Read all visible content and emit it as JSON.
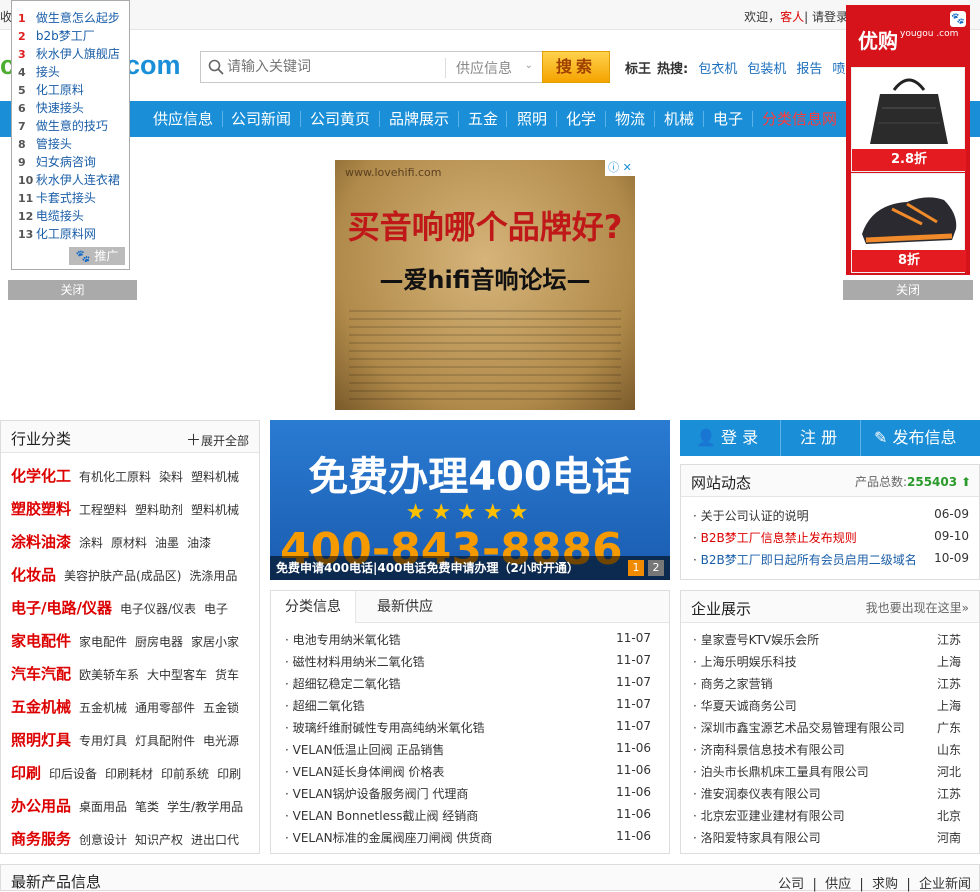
{
  "topbar": {
    "fav": "收",
    "welcome": "欢迎，",
    "guest": "客人",
    "login_hint": "| 请登录"
  },
  "logo": {
    "text": "com"
  },
  "search": {
    "placeholder": "请输入关键词",
    "category": "供应信息",
    "button": "搜索"
  },
  "hot": {
    "label1": "标王",
    "label2": "热搜:",
    "links": [
      "包衣机",
      "包装机",
      "报告",
      "喷雾"
    ]
  },
  "nav": {
    "items": [
      "供应信息",
      "公司新闻",
      "公司黄页",
      "品牌展示",
      "五金",
      "照明",
      "化学",
      "物流",
      "机械",
      "电子",
      "分类信息网"
    ]
  },
  "left_float": {
    "items": [
      {
        "n": "1",
        "t": "做生意怎么起步"
      },
      {
        "n": "2",
        "t": "b2b梦工厂"
      },
      {
        "n": "3",
        "t": "秋水伊人旗舰店"
      },
      {
        "n": "4",
        "t": "接头"
      },
      {
        "n": "5",
        "t": "化工原料"
      },
      {
        "n": "6",
        "t": "快速接头"
      },
      {
        "n": "7",
        "t": "做生意的技巧"
      },
      {
        "n": "8",
        "t": "管接头"
      },
      {
        "n": "9",
        "t": "妇女病咨询"
      },
      {
        "n": "10",
        "t": "秋水伊人连衣裙"
      },
      {
        "n": "11",
        "t": "卡套式接头"
      },
      {
        "n": "12",
        "t": "电缆接头"
      },
      {
        "n": "13",
        "t": "化工原料网"
      }
    ],
    "promo": "推广",
    "close": "关闭"
  },
  "right_float": {
    "brand": "优购",
    "brand_sub": "yougou .com",
    "prices": [
      "2.8折",
      "8折"
    ],
    "close": "关闭"
  },
  "ad": {
    "url": "www.lovehifi.com",
    "headline": "买音响哪个品牌好?",
    "subline": "—爱hifi音响论坛—"
  },
  "industry": {
    "title": "行业分类",
    "expand": "展开全部",
    "rows": [
      {
        "main": "化学化工",
        "subs": [
          "有机化工原料",
          "染料",
          "塑料机械"
        ]
      },
      {
        "main": "塑胶塑料",
        "subs": [
          "工程塑料",
          "塑料助剂",
          "塑料机械"
        ]
      },
      {
        "main": "涂料油漆",
        "subs": [
          "涂料",
          "原材料",
          "油墨",
          "油漆"
        ]
      },
      {
        "main": "化妆品",
        "subs": [
          "美容护肤产品(成品区)",
          "洗涤用品"
        ]
      },
      {
        "main": "电子/电路/仪器",
        "subs": [
          "电子仪器",
          "/仪表",
          "电子"
        ]
      },
      {
        "main": "家电配件",
        "subs": [
          "家电配件",
          "厨房电器",
          "家居小家"
        ]
      },
      {
        "main": "汽车汽配",
        "subs": [
          "欧美轿车系",
          "大中型客车",
          "货车"
        ]
      },
      {
        "main": "五金机械",
        "subs": [
          "五金机械",
          "通用零部件",
          "五金锁"
        ]
      },
      {
        "main": "照明灯具",
        "subs": [
          "专用灯具",
          "灯具配附件",
          "电光源"
        ]
      },
      {
        "main": "印刷",
        "subs": [
          "印后设备",
          "印刷耗材",
          "印前系统",
          "印刷"
        ]
      },
      {
        "main": "办公用品",
        "subs": [
          "桌面用品",
          "笔类",
          "学生/教学用品"
        ]
      },
      {
        "main": "商务服务",
        "subs": [
          "创意设计",
          "知识产权",
          "进出口代"
        ]
      }
    ]
  },
  "banner": {
    "title": "免费办理400电话",
    "stars": "★★★★★",
    "number": "400-843-8886",
    "caption": "免费申请400电话|400电话免费申请办理（2小时开通）",
    "pages": [
      "1",
      "2"
    ]
  },
  "auth": {
    "login": "登 录",
    "register": "注 册",
    "publish": "发布信息"
  },
  "news": {
    "title": "网站动态",
    "count_label": "产品总数:",
    "count": "255403",
    "items": [
      {
        "t": "关于公司认证的说明",
        "d": "06-09",
        "red": false
      },
      {
        "t": "B2B梦工厂信息禁止发布规则",
        "d": "09-10",
        "red": true
      },
      {
        "t": "B2B梦工厂即日起所有会员启用二级域名",
        "d": "10-09",
        "red": false
      }
    ]
  },
  "classified": {
    "tabs": [
      "分类信息",
      "最新供应"
    ],
    "items": [
      {
        "t": "电池专用纳米氧化锆",
        "d": "11-07"
      },
      {
        "t": "磁性材料用纳米二氧化锆",
        "d": "11-07"
      },
      {
        "t": "超细钇稳定二氧化锆",
        "d": "11-07"
      },
      {
        "t": "超细二氧化锆",
        "d": "11-07"
      },
      {
        "t": "玻璃纤维耐碱性专用高纯纳米氧化锆",
        "d": "11-07"
      },
      {
        "t": "VELAN低温止回阀 正品销售",
        "d": "11-06"
      },
      {
        "t": "VELAN延长身体闸阀 价格表",
        "d": "11-06"
      },
      {
        "t": "VELAN锅炉设备服务阀门 代理商",
        "d": "11-06"
      },
      {
        "t": "VELAN Bonnetless截止阀 经销商",
        "d": "11-06"
      },
      {
        "t": "VELAN标准的金属阀座刀闸阀 供货商",
        "d": "11-06"
      }
    ]
  },
  "companies": {
    "title": "企业展示",
    "more": "我也要出现在这里»",
    "items": [
      {
        "t": "皇家壹号KTV娱乐会所",
        "p": "江苏"
      },
      {
        "t": "上海乐明娱乐科技",
        "p": "上海"
      },
      {
        "t": "商务之家营销",
        "p": "江苏"
      },
      {
        "t": "华夏天诚商务公司",
        "p": "上海"
      },
      {
        "t": "深圳市鑫宝源艺术品交易管理有限公司",
        "p": "广东"
      },
      {
        "t": "济南科景信息技术有限公司",
        "p": "山东"
      },
      {
        "t": "泊头市长鼎机床工量具有限公司",
        "p": "河北"
      },
      {
        "t": "淮安润泰仪表有限公司",
        "p": "江苏"
      },
      {
        "t": "北京宏亚建业建材有限公司",
        "p": "北京"
      },
      {
        "t": "洛阳爱特家具有限公司",
        "p": "河南"
      }
    ]
  },
  "bottom": {
    "title": "最新产品信息",
    "links": [
      "公司",
      "供应",
      "求购",
      "企业新闻"
    ]
  }
}
